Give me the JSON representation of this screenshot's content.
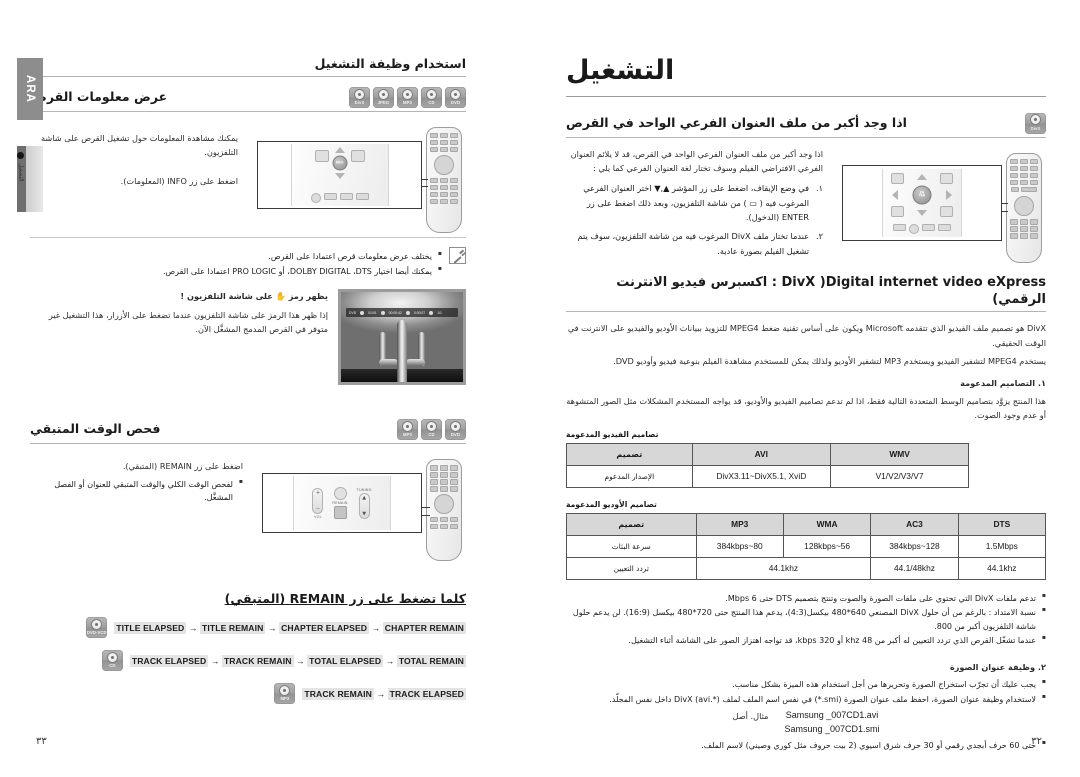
{
  "meta": {
    "language_tab": "ARA",
    "side_badge_text": "التشغيل"
  },
  "left_page": {
    "page_number": "٣٣",
    "header": "استخدام وظيفة التشغيل",
    "sections": [
      {
        "title": "عرض معلومات القرص",
        "disc_icons": [
          "DVD",
          "CD",
          "MP3",
          "JPEG",
          "DivX"
        ],
        "body": [
          "يمكنك مشاهدة المعلومات حول تشغيل القرص على شاشة التلفزيون.",
          "اضغط على زر INFO (المعلومات)."
        ],
        "notes": [
          "يختلف عرض معلومات قرص اعتمادا على القرص.",
          "يمكنك أيضا اختيار DOLBY DIGITAL ،DTS، أو PRO LOGIC اعتمادا على القرص."
        ],
        "tip_title": "يظهر رمز ✋ على شاشة التلفزيون !",
        "tip_body": "إذا ظهر هذا الرمز على شاشة التلفزيون عندما تضغط على الأزرار، هذا التشغيل غير متوفر في القرص المدمج المشغَّل الآن.",
        "tv_osd": [
          "DVD",
          "01/01",
          "00:00:42",
          "0:00:07",
          "1/1"
        ]
      },
      {
        "title": "فحص الوقت المتبقي",
        "disc_icons": [
          "DVD",
          "CD",
          "MP3"
        ],
        "body": [
          "اضغط على زر REMAIN (المتبقي)."
        ],
        "bullets": [
          "لفحص الوقت الكلي والوقت المتبقي للعنوان أو الفصل المشغَّل."
        ],
        "remote_keys": [
          "VOL",
          "REMAIN",
          "TUNING"
        ]
      }
    ],
    "sequence_heading": "كلما تضغط على زر REMAIN (المتبقي)",
    "sequences": [
      {
        "icon": "DVD-VCD",
        "steps": [
          "TITLE ELAPSED",
          "TITLE REMAIN",
          "CHAPTER ELAPSED",
          "CHAPTER REMAIN"
        ]
      },
      {
        "icon": "CD",
        "steps": [
          "TRACK ELAPSED",
          "TRACK REMAIN",
          "TOTAL ELAPSED",
          "TOTAL REMAIN"
        ]
      },
      {
        "icon": "MP3",
        "steps": [
          "TRACK REMAIN",
          "TRACK ELAPSED"
        ]
      }
    ]
  },
  "right_page": {
    "page_number": "٣٢",
    "chapter_title": "التشغيل",
    "section_subtitle": {
      "title": "اذا وجد أكبر من ملف العنوان الفرعي الواحد في القرص",
      "disc_icons": [
        "DivX"
      ],
      "intro": "اذا وجد أكبر من ملف العنوان الفرعي الواحد في القرص، قد لا يلائم العنوان الفرعي الافتراضي الفيلم وسوف تختار لغة العنوان الفرعي كما يلي :",
      "steps": [
        {
          "num": "١.",
          "text": "في وضع الإيقاف، اضغط على زر المؤشر ▲,▼ اختر العنوان الفرعي المرغوب فيه ( ▭ ) من شاشة التلفزيون، وبعد ذلك اضغط على زر ENTER (الدخول)."
        },
        {
          "num": "٢.",
          "text": "عندما تختار ملف DivX المرغوب فيه من شاشة التلفزيون، سوف يتم تشغيل الفيلم بصورة عادية."
        }
      ]
    },
    "divx": {
      "title": "DivX )Digital internet video eXpress : اكسبرس فيديو الانترنت الرقمي)",
      "paragraphs": [
        "DivX هو تصميم ملف الفيديو الذي تتقدمه Microsoft ويكون على أساس تقنية ضغط MPEG4 للتزويد ببيانات الأوديو والفيديو على الانترنت في الوقت الحقيقي.",
        "يستخدم MPEG4 لتشفير الفيديو ويستخدم MP3 لتشفير الأوديو ولذلك يمكن للمستخدم مشاهدة الفيلم بنوعية فيديو وأوديو DVD."
      ],
      "item1_title": "١. التصاميم المدعومة",
      "item1_body": "هذا المنتج يزوَّد بتصاميم الوسط المتعددة التالية فقط، اذا لم تدعم تصاميم الفيديو والأوديو، قد يواجه المستخدم المشكلات مثل الصور المتشوهة أو عدم وجود الصوت.",
      "video_table_caption": "تصاميم الفيديو المدعومة",
      "video_table": {
        "headers": [
          "WMV",
          "AVI",
          "تصميم"
        ],
        "rows": [
          [
            "V1/V2/V3/V7",
            "DivX3.11~DivX5.1, XviD",
            "الإصدار المدعوم"
          ]
        ]
      },
      "audio_table_caption": "تصاميم الأوديو المدعومة",
      "audio_table": {
        "headers": [
          "DTS",
          "AC3",
          "WMA",
          "MP3",
          "تصميم"
        ],
        "rows": [
          [
            "1.5Mbps",
            "384kbps~128",
            "128kbps~56",
            "384kbps~80",
            "سرعة البثات"
          ],
          [
            "44.1khz",
            "44.1/48khz",
            "44.1khz",
            "",
            "تردد التعيين"
          ]
        ]
      },
      "bullets": [
        "تدعم ملفات DivX التي تحتوي على ملفات الصورة والصوت وتنتج بتصميم DTS حتى Mbps 6.",
        "نسبة الامتداد : بالرغم من أن حلول DivX المصنعي 640*480 بيكسل(4:3)، يدعم هذا المنتج حتى 720*480 بيكسل (16:9). لن يدعم حلول شاشة التلفزيون أكبر من 800.",
        "عندما تشغّل القرص الذي تردد التعيين له أكبر من 48 khz أو 320 kbps، قد تواجه اهتزاز الصور على الشاشة أثناء التشغيل."
      ],
      "item2_title": "٢. وظيفة عنوان الصورة",
      "item2_bullets": [
        "يجب عليك أن تجرّب استخراج الصورة وتحريرها من أجل استخدام هذه الميزة بشكل مناسب.",
        "لاستخدام وظيفة عنوان الصورة، احفظ ملف عنوان الصورة (smi.*) في نفس اسم الملف لملف DivX (avi.*) داخل نفس المجلّد.",
        "حتى 60 حرف أبجدي رقمي أو 30 حرف شرق اسيوي (2 بيت حروف مثل كوري وصيني) لاسم الملف."
      ],
      "example_label": "مثال. أصل",
      "example_files": [
        "Samsung _007CD1.avi",
        "Samsung _007CD1.smi"
      ]
    }
  }
}
